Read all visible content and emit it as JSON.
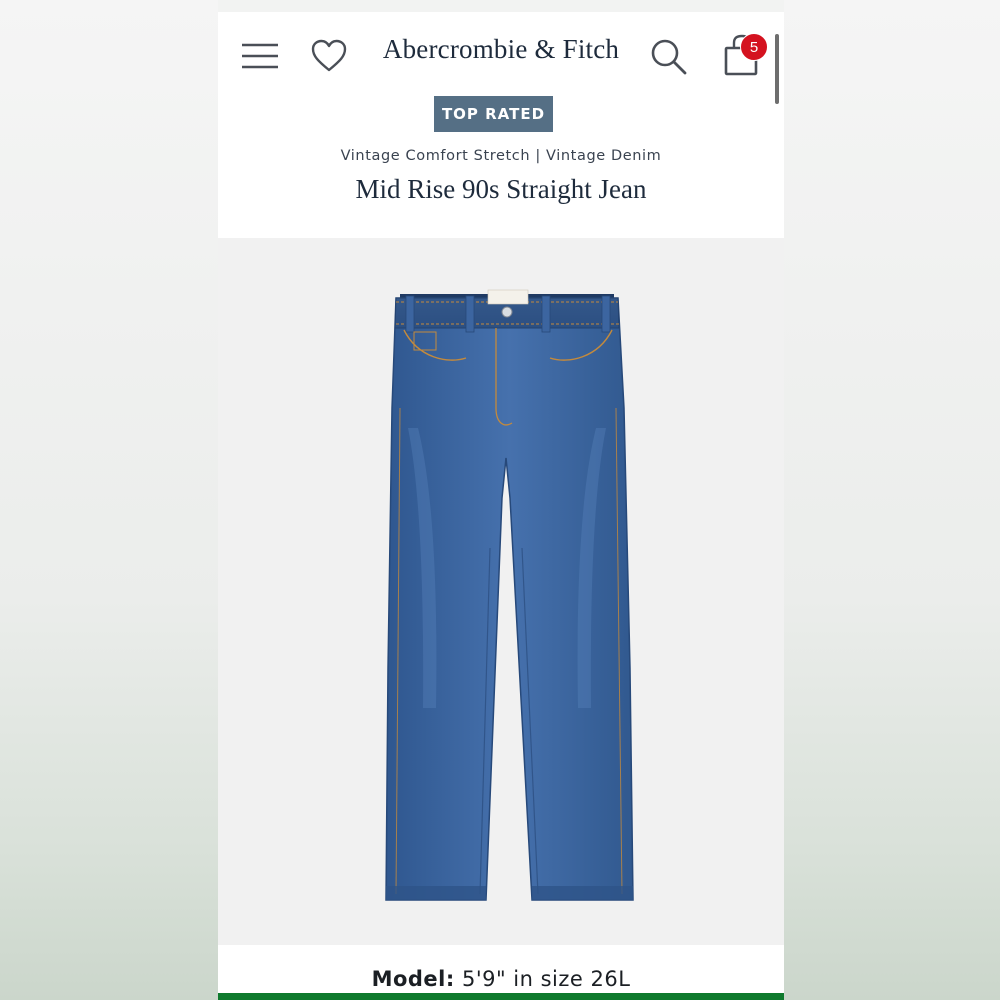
{
  "header": {
    "logo_text": "Abercrombie & Fitch",
    "cart_count": "5",
    "icons": [
      "menu-icon",
      "heart-icon",
      "search-icon",
      "shopping-bag-icon"
    ]
  },
  "product": {
    "badge": "TOP RATED",
    "collection": "Vintage Comfort Stretch | Vintage Denim",
    "title": "Mid Rise 90s Straight Jean",
    "image": "blue-denim-jeans"
  },
  "model": {
    "label": "Model:",
    "value": "5'9\" in size 26L"
  },
  "colors": {
    "badge_bg": "#556f85",
    "cart_badge": "#d4121f",
    "accent_bar": "#0f7a2e",
    "denim": "#3a62a0"
  }
}
